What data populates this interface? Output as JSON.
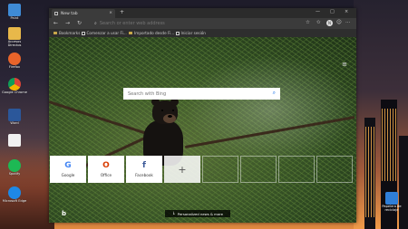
{
  "desktop": {
    "icons_left": [
      {
        "label": "Paint",
        "icon": "paint-icon",
        "color": "#3f8bd6"
      },
      {
        "label": "Accesos Directos",
        "icon": "folder-icon",
        "color": "#e8b84a"
      },
      {
        "label": "Firefox",
        "icon": "firefox-icon",
        "color": "#e8642a"
      },
      {
        "label": "Google Chrome",
        "icon": "chrome-icon",
        "color": "#4caf50"
      },
      {
        "label": "Word",
        "icon": "word-icon",
        "color": "#2b579a"
      },
      {
        "label": "",
        "icon": "document-icon",
        "color": "#f1f1f1"
      },
      {
        "label": "Spotify",
        "icon": "spotify-icon",
        "color": "#1db954"
      },
      {
        "label": "Microsoft Edge",
        "icon": "edge-icon",
        "color": "#1e88e5"
      }
    ],
    "icon_right": {
      "label": "Papelera de reciclaje",
      "icon": "recycle-bin-icon"
    }
  },
  "browser": {
    "tab_title": "New tab",
    "tab_close": "×",
    "new_tab": "+",
    "window_controls": {
      "minimize": "—",
      "maximize": "□",
      "close": "×"
    },
    "nav": {
      "back": "←",
      "forward": "→",
      "refresh": "↻"
    },
    "address_placeholder": "Search or enter web address",
    "toolbar": {
      "star": "☆",
      "favorites": "✩",
      "avatar": "N",
      "feedback": "☺",
      "more": "···"
    },
    "favorites": [
      {
        "label": "Bookmarks"
      },
      {
        "label": "Comenzar a usar Fi..."
      },
      {
        "label": "Importado desde Fi..."
      },
      {
        "label": "Iniciar sesión"
      }
    ]
  },
  "newtab": {
    "settings_icon": "≡",
    "search_placeholder": "Search with Bing",
    "search_icon": "⌕",
    "tiles": [
      {
        "label": "Google",
        "logo": "G",
        "color": "#4285f4"
      },
      {
        "label": "Office",
        "logo": "O",
        "color": "#d83b01"
      },
      {
        "label": "Facebook",
        "logo": "f",
        "color": "#3b5998"
      },
      {
        "label": "",
        "logo": "+",
        "color": "#555555"
      }
    ],
    "news_label": "Personalized news & more",
    "news_arrow": "↓",
    "bing_logo": "b"
  }
}
